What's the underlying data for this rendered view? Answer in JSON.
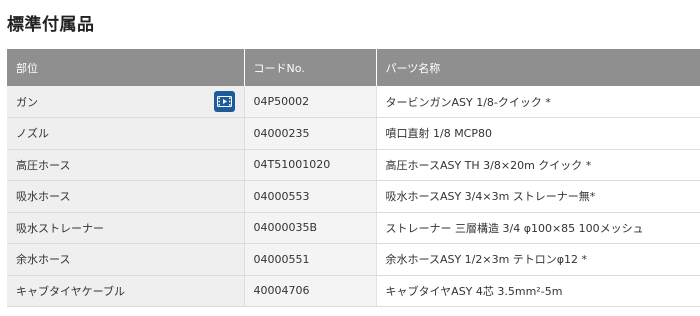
{
  "page": {
    "title": "標準付属品"
  },
  "table": {
    "headers": {
      "part": "部位",
      "code": "コードNo.",
      "name": "パーツ名称"
    },
    "rows": [
      {
        "part": "ガン",
        "code": "04P50002",
        "name": "タービンガンASY 1/8-クイック *",
        "video_icon": "video-icon"
      },
      {
        "part": "ノズル",
        "code": "04000235",
        "name": "噴口直射 1/8 MCP80"
      },
      {
        "part": "高圧ホース",
        "code": "04T51001020",
        "name": "高圧ホースASY TH 3/8×20m クイック *"
      },
      {
        "part": "吸水ホース",
        "code": "04000553",
        "name": "吸水ホースASY 3/4×3m ストレーナー無*"
      },
      {
        "part": "吸水ストレーナー",
        "code": "04000035B",
        "name": "ストレーナー 三層構造 3/4 φ100×85 100メッシュ"
      },
      {
        "part": "余水ホース",
        "code": "04000551",
        "name": "余水ホースASY 1/2×3m テトロンφ12 *"
      },
      {
        "part": "キャブタイヤケーブル",
        "code": "40004706",
        "name": "キャブタイヤASY 4芯 3.5mm²-5m"
      }
    ]
  },
  "colors": {
    "header_bg": "#8f8f8f",
    "video_button": "#1c5c9c"
  }
}
